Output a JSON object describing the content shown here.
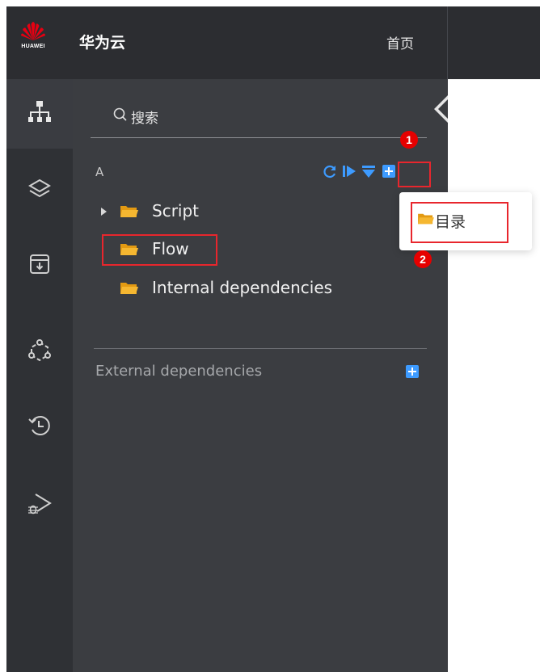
{
  "header": {
    "logo_wordmark": "HUAWEI",
    "brand_name": "华为云",
    "home_link": "首页"
  },
  "icon_rail": {
    "items": [
      {
        "icon": "hierarchy-icon",
        "active": true
      },
      {
        "icon": "layers-icon",
        "active": false
      },
      {
        "icon": "archive-download-icon",
        "active": false
      },
      {
        "icon": "workflow-nodes-icon",
        "active": false
      },
      {
        "icon": "history-icon",
        "active": false
      },
      {
        "icon": "debug-run-icon",
        "active": false
      }
    ]
  },
  "panel": {
    "search": {
      "placeholder": "搜索"
    },
    "section_label": "A",
    "toolbar": [
      "refresh-icon",
      "run-icon",
      "filter-icon",
      "add-icon"
    ],
    "tree": [
      {
        "label": "Script",
        "expandable": true
      },
      {
        "label": "Flow",
        "expandable": false
      },
      {
        "label": "Internal dependencies",
        "expandable": false
      }
    ],
    "external_label": "External dependencies"
  },
  "popup_menu": {
    "items": [
      {
        "label": "目录",
        "icon": "folder-icon"
      }
    ]
  },
  "annotations": {
    "badge1": "1",
    "badge2": "2"
  },
  "colors": {
    "header_bg": "#2c2d31",
    "rail_bg": "#2f3135",
    "panel_bg": "#3b3d41",
    "accent_blue": "#3d9bff",
    "folder_yellow": "#f5b731",
    "highlight_red": "#e8262d"
  }
}
